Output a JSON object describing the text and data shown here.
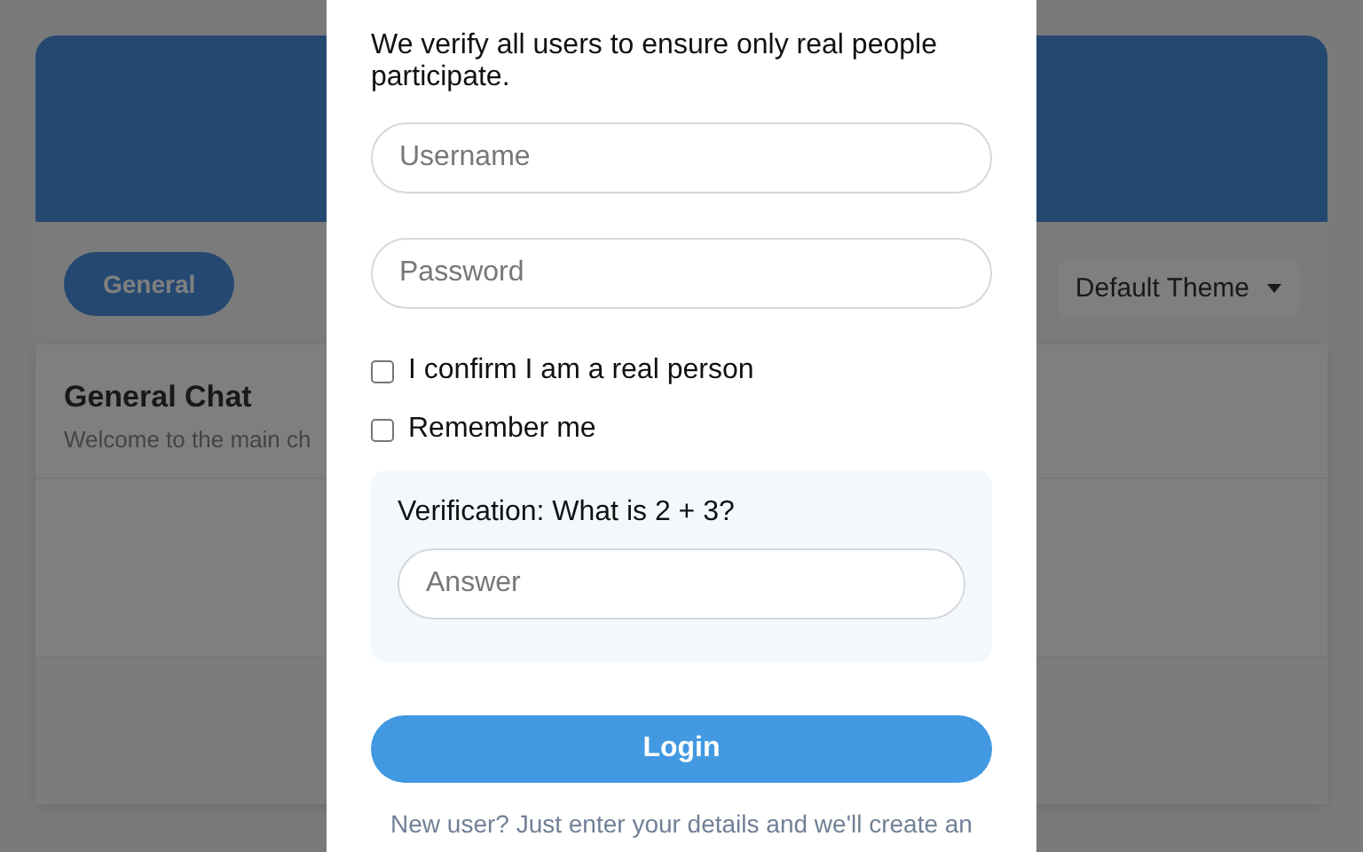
{
  "background": {
    "tabs": [
      {
        "label": "General",
        "selected": true
      }
    ],
    "theme_select": {
      "value": "Default Theme"
    },
    "chat": {
      "title": "General Chat",
      "subtitle": "Welcome to the main ch"
    }
  },
  "dialog": {
    "description": "We verify all users to ensure only real people participate.",
    "fields": [
      {
        "placeholder": "Username"
      },
      {
        "placeholder": "Password"
      }
    ],
    "checkboxes": [
      {
        "label": "I confirm I am a real person",
        "checked": false
      },
      {
        "label": "Remember me",
        "checked": false
      }
    ],
    "verification": {
      "question": "Verification: What is 2 + 3?",
      "placeholder": "Answer"
    },
    "button": "Login",
    "footer": "New user? Just enter your details and we'll create an"
  }
}
